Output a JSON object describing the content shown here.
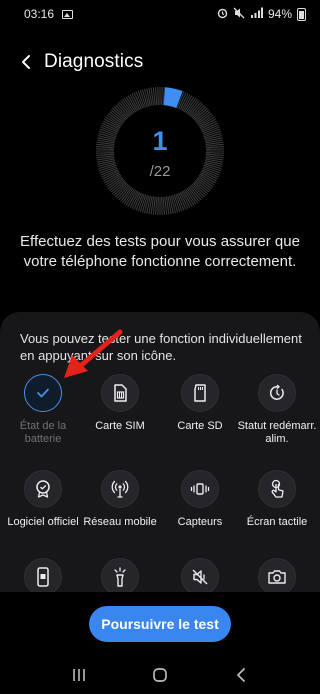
{
  "status_bar": {
    "time": "03:16",
    "battery": "94%"
  },
  "header": {
    "title": "Diagnostics"
  },
  "progress": {
    "count": "1",
    "total": "/22",
    "completed_fraction": 0.045,
    "accent": "#3e8ff0"
  },
  "description": "Effectuez des tests pour vous assurer que votre téléphone fonctionne correctement.",
  "sheet": {
    "hint": "Vous pouvez tester une fonction individuellement en appuyant sur son icône."
  },
  "tests": [
    {
      "label": "État de la batterie",
      "icon": "checkmark-icon",
      "done": true
    },
    {
      "label": "Carte SIM",
      "icon": "sim-card-icon"
    },
    {
      "label": "Carte SD",
      "icon": "sd-card-icon"
    },
    {
      "label": "Statut redémarr. alim.",
      "icon": "restart-icon"
    },
    {
      "label": "Logiciel officiel",
      "icon": "certificate-icon"
    },
    {
      "label": "Réseau mobile",
      "icon": "cell-tower-icon"
    },
    {
      "label": "Capteurs",
      "icon": "sensors-icon"
    },
    {
      "label": "Écran tactile",
      "icon": "touch-icon"
    },
    {
      "label": "",
      "icon": "phone-icon"
    },
    {
      "label": "",
      "icon": "flashlight-icon"
    },
    {
      "label": "",
      "icon": "mute-icon"
    },
    {
      "label": "",
      "icon": "camera-icon"
    }
  ],
  "footer": {
    "button": "Poursuivre le test"
  }
}
